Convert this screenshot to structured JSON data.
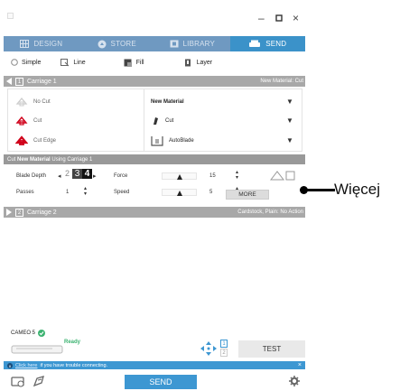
{
  "window": {
    "minimize": "–",
    "maximize": "▫",
    "close": "×"
  },
  "tabs": [
    {
      "label": "DESIGN",
      "icon": "grid-icon"
    },
    {
      "label": "STORE",
      "icon": "store-icon"
    },
    {
      "label": "LIBRARY",
      "icon": "library-icon"
    },
    {
      "label": "SEND",
      "icon": "send-icon"
    }
  ],
  "modes": [
    {
      "label": "Simple"
    },
    {
      "label": "Line"
    },
    {
      "label": "Fill"
    },
    {
      "label": "Layer"
    }
  ],
  "carriage1": {
    "number": "1",
    "label": "Carriage 1",
    "right": "New Material: Cut"
  },
  "panel": {
    "rows": [
      {
        "option": "No Cut",
        "setting": "New Material"
      },
      {
        "option": "Cut",
        "setting": "Cut"
      },
      {
        "option": "Cut Edge",
        "setting": "AutoBlade"
      }
    ]
  },
  "cut_note": {
    "prefix": "Cut",
    "bold": "New Material",
    "suffix": "Using Carriage 1"
  },
  "settings": {
    "blade_depth_label": "Blade Depth",
    "blade_values": [
      "2",
      "3",
      "4"
    ],
    "force_label": "Force",
    "force_value": "15",
    "passes_label": "Passes",
    "passes_value": "1",
    "speed_label": "Speed",
    "speed_value": "5",
    "more_label": "MORE"
  },
  "carriage2": {
    "number": "2",
    "label": "Carriage 2",
    "right": "Cardstock, Plain: No Action"
  },
  "device": {
    "name": "CAMEO 5",
    "ready": "Ready",
    "test_label": "TEST",
    "slot1": "1",
    "slot2": "2"
  },
  "info": {
    "link": "Click here",
    "text": "if you have trouble connecting.",
    "close": "×"
  },
  "bottom": {
    "send_label": "SEND"
  },
  "callout": {
    "label": "Więcej"
  },
  "colors": {
    "accent": "#3d97d2",
    "tab_bar": "#6f99c1",
    "carriage_bar": "#a8a8a8",
    "cut_red": "#d0021b",
    "ready_green": "#3cb371"
  }
}
